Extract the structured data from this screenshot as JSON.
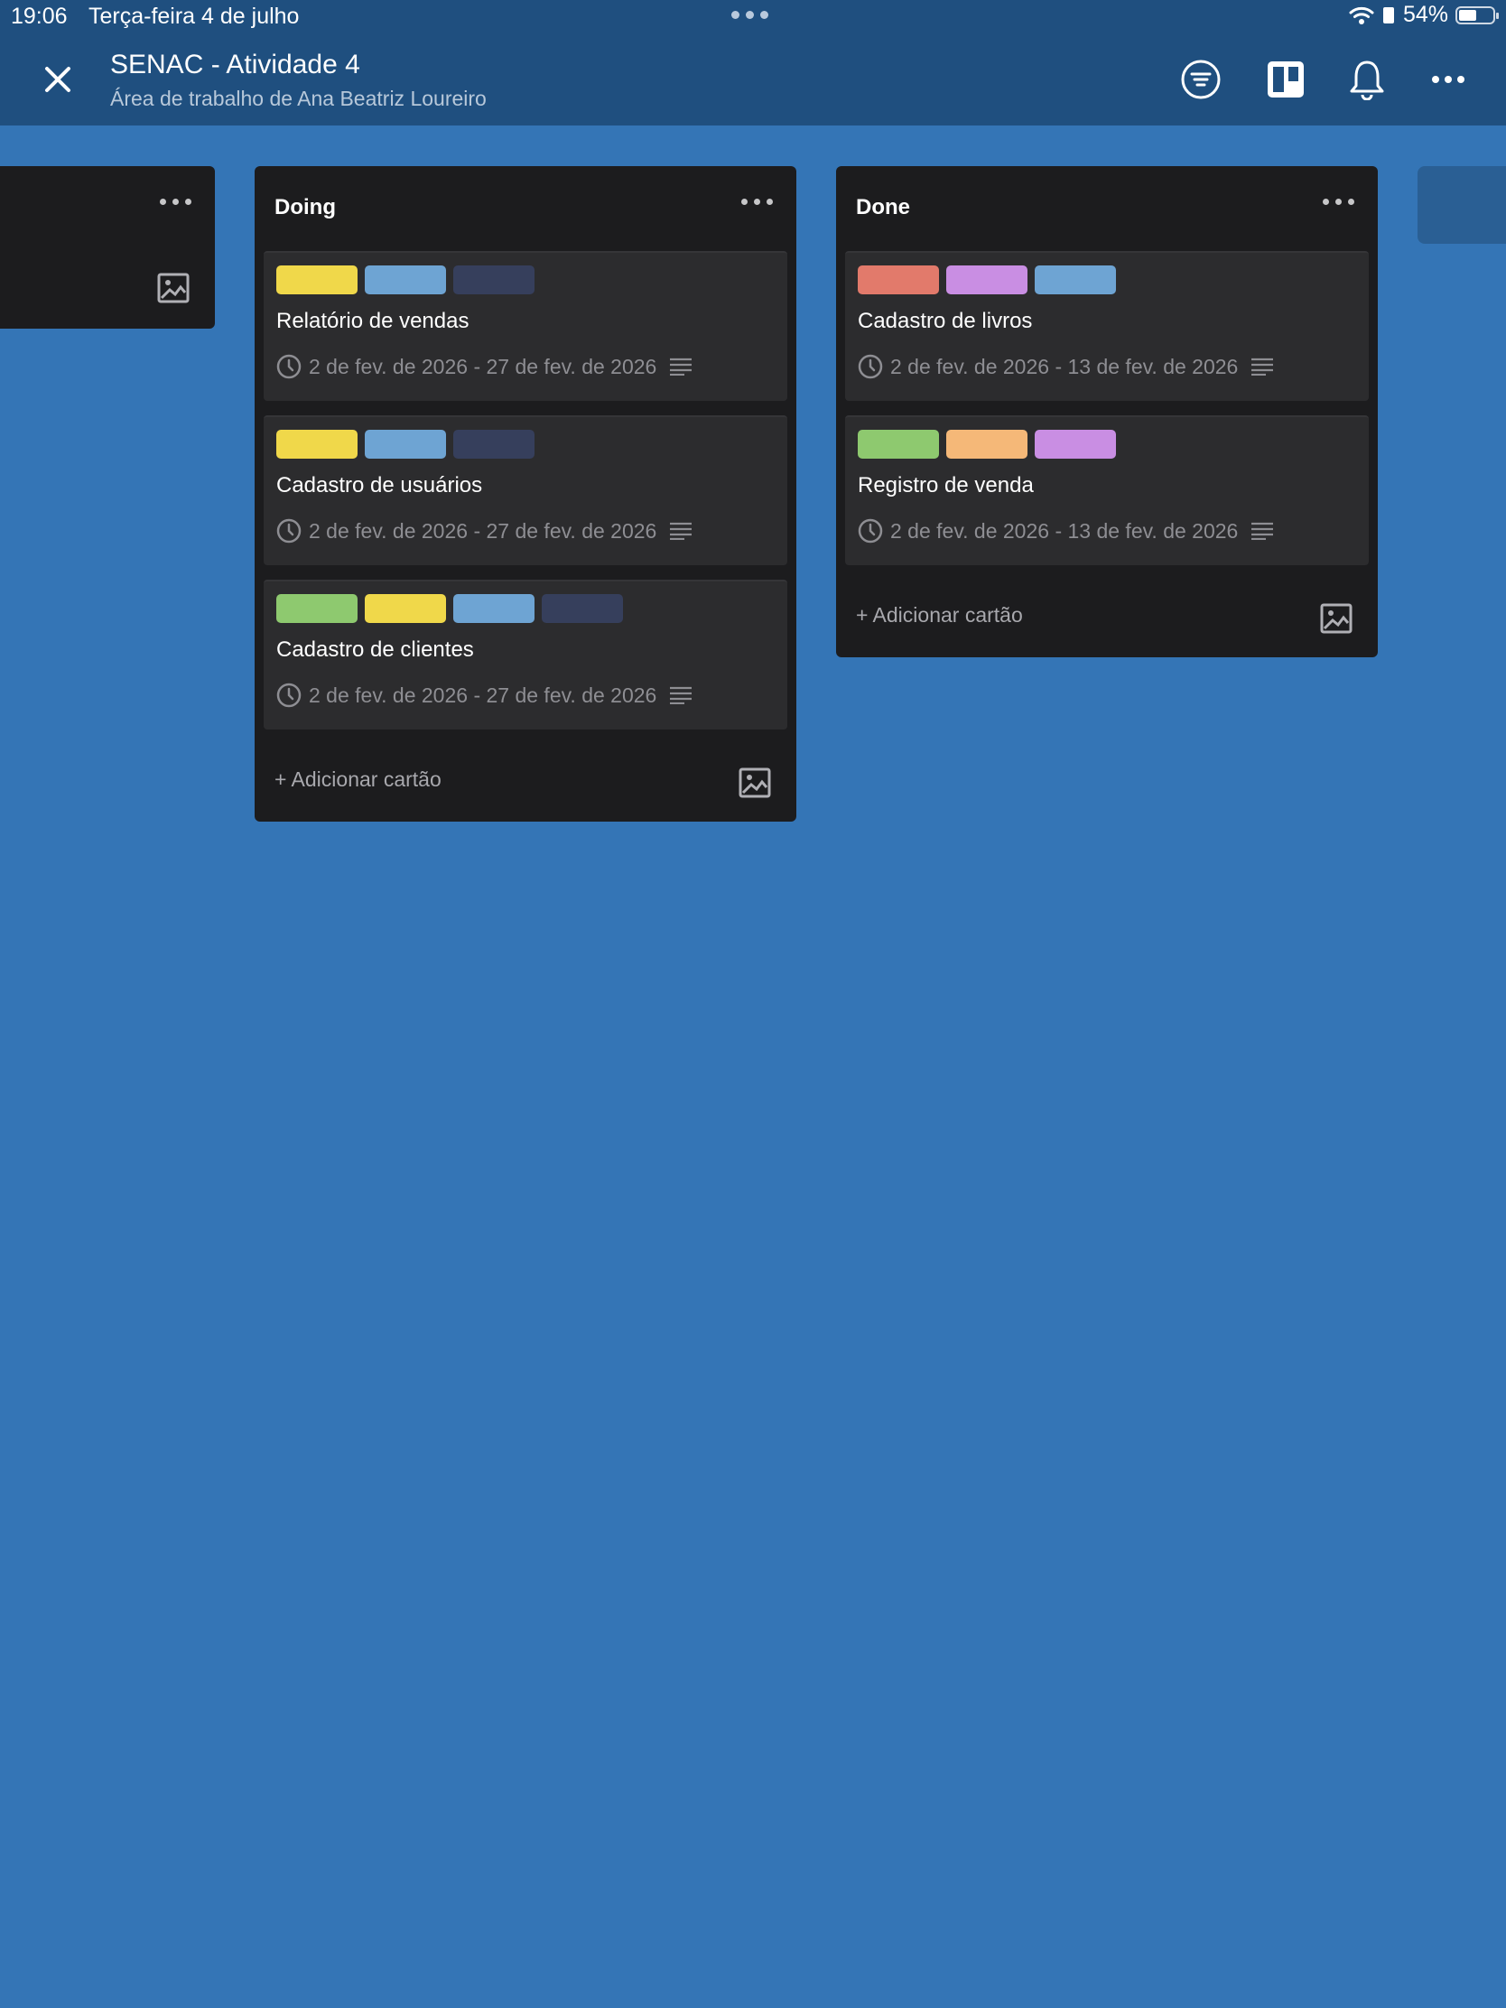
{
  "status_bar": {
    "time": "19:06",
    "date": "Terça-feira 4 de julho",
    "battery": "54%",
    "battery_level": 0.54
  },
  "header": {
    "title": "SENAC - Atividade 4",
    "subtitle": "Área de trabalho de Ana Beatriz Loureiro",
    "icons": [
      "close-icon",
      "filter-icon",
      "board-view-icon",
      "bell-icon",
      "more-icon"
    ]
  },
  "lists": [
    {
      "name": "Doing",
      "add_card": "+ Adicionar cartão",
      "cards": [
        {
          "title": "Relatório de vendas",
          "dates": "2 de fev. de 2026 - 27 de fev. de 2026",
          "labels": [
            "#f0d84a",
            "#6ea4d3",
            "#363f5c"
          ]
        },
        {
          "title": "Cadastro de usuários",
          "dates": "2 de fev. de 2026 - 27 de fev. de 2026",
          "labels": [
            "#f0d84a",
            "#6ea4d3",
            "#363f5c"
          ]
        },
        {
          "title": "Cadastro de clientes",
          "dates": "2 de fev. de 2026 - 27 de fev. de 2026",
          "labels": [
            "#8ec96f",
            "#f0d84a",
            "#6ea4d3",
            "#363f5c"
          ]
        }
      ]
    },
    {
      "name": "Done",
      "add_card": "+ Adicionar cartão",
      "cards": [
        {
          "title": "Cadastro de livros",
          "dates": "2 de fev. de 2026 - 13 de fev. de 2026",
          "labels": [
            "#e27a6b",
            "#c98ee3",
            "#6ea4d3"
          ]
        },
        {
          "title": "Registro de venda",
          "dates": "2 de fev. de 2026 - 13 de fev. de 2026",
          "labels": [
            "#8ec96f",
            "#f5b878",
            "#c98ee3"
          ]
        }
      ]
    }
  ],
  "colors": {
    "background": "#3475b6",
    "header": "#1f4f7f",
    "list": "#1c1c1e",
    "card": "#2c2c2e"
  }
}
